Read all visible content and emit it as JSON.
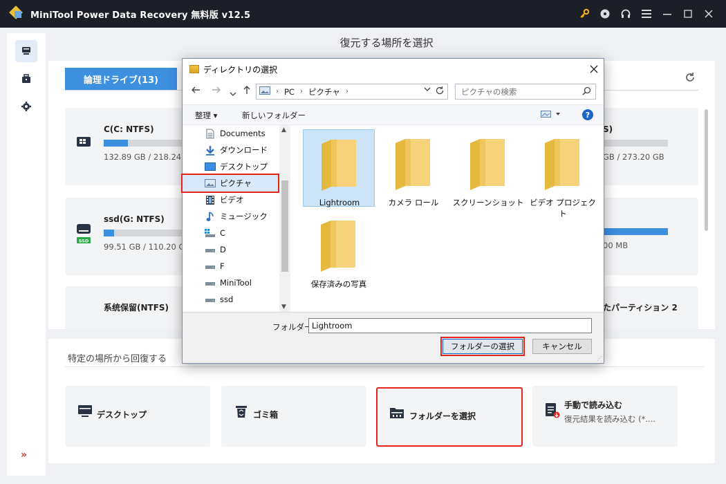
{
  "app": {
    "title": "MiniTool Power Data Recovery 無料版 v12.5"
  },
  "main": {
    "header": "復元する場所を選択",
    "tab_logical": "論理ドライブ(13)",
    "drives": [
      {
        "name": "C(C: NTFS)",
        "size": "132.89 GB / 218.24 GB",
        "fill": 0.23
      },
      {
        "name": "S)",
        "size": "GB / 273.20 GB",
        "fill": 0.0
      },
      {
        "name": "ssd(G: NTFS)",
        "size": "99.51 GB / 110.20 GB",
        "fill": 0.1
      },
      {
        "name": "",
        "size": "00 MB",
        "fill": 1.0
      },
      {
        "name": "系统保留(NTFS)",
        "size": ""
      },
      {
        "name": "たパーティション 2",
        "size": ""
      }
    ]
  },
  "locations": {
    "title": "特定の場所から回復する",
    "items": [
      {
        "label": "デスクトップ",
        "sub": ""
      },
      {
        "label": "ゴミ箱",
        "sub": ""
      },
      {
        "label": "フォルダーを選択",
        "sub": ""
      },
      {
        "label": "手動で読み込む",
        "sub": "復元結果を読み込む (*...."
      }
    ]
  },
  "dialog": {
    "title": "ディレクトリの選択",
    "breadcrumb": [
      "PC",
      "ピクチャ"
    ],
    "search_placeholder": "ピクチャの検索",
    "organize": "整理 ▾",
    "new_folder": "新しいフォルダー",
    "nav_items": [
      {
        "label": "Documents",
        "icon": "document-icon"
      },
      {
        "label": "ダウンロード",
        "icon": "download-icon"
      },
      {
        "label": "デスクトップ",
        "icon": "desktop-icon"
      },
      {
        "label": "ピクチャ",
        "icon": "pictures-icon"
      },
      {
        "label": "ビデオ",
        "icon": "video-icon"
      },
      {
        "label": "ミュージック",
        "icon": "music-icon"
      },
      {
        "label": "C",
        "icon": "drive-icon"
      },
      {
        "label": "D",
        "icon": "drive-icon"
      },
      {
        "label": "F",
        "icon": "drive-icon"
      },
      {
        "label": "MiniTool",
        "icon": "drive-icon"
      },
      {
        "label": "ssd",
        "icon": "drive-icon"
      }
    ],
    "folders": [
      "Lightroom",
      "カメラ ロール",
      "スクリーンショット",
      "ビデオ プロジェクト",
      "保存済みの写真"
    ],
    "folder_label": "フォルダー:",
    "folder_value": "Lightroom",
    "select_button": "フォルダーの選択",
    "cancel_button": "キャンセル"
  },
  "colors": {
    "accent": "#3d8fe0",
    "titlebar": "#1c1f27",
    "highlight": "#e3241b"
  }
}
